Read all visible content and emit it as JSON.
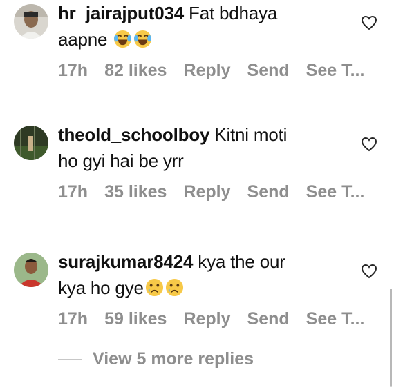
{
  "comments": [
    {
      "username": "hr_jairajput034",
      "text_line1": "Fat bdhaya",
      "text_line2": "aapne",
      "emojis": [
        "joy-emoji",
        "joy-emoji"
      ],
      "time": "17h",
      "likes": "82 likes",
      "reply": "Reply",
      "send": "Send",
      "see_translation": "See T..."
    },
    {
      "username": "theold_schoolboy",
      "text_line1": "Kitni moti",
      "text_line2": "ho gyi hai be yrr",
      "emojis": [],
      "time": "17h",
      "likes": "35 likes",
      "reply": "Reply",
      "send": "Send",
      "see_translation": "See T..."
    },
    {
      "username": "surajkumar8424",
      "text_line1": "kya the our",
      "text_line2": "kya ho gye",
      "emojis": [
        "crying-emoji",
        "crying-emoji"
      ],
      "time": "17h",
      "likes": "59 likes",
      "reply": "Reply",
      "send": "Send",
      "see_translation": "See T..."
    }
  ],
  "view_more_replies": "View 5 more replies",
  "colors": {
    "text": "#111111",
    "muted": "#8e8e8e",
    "emoji_face": "#f7c948"
  }
}
